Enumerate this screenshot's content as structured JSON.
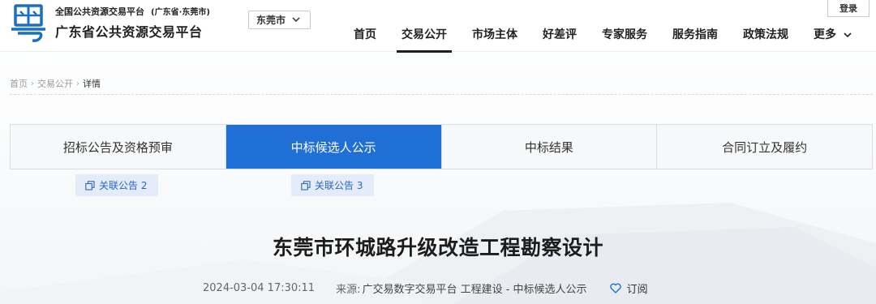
{
  "header": {
    "platform_top": "全国公共资源交易平台",
    "platform_region": "(广东省·东莞市)",
    "platform_name": "广东省公共资源交易平台",
    "city_selected": "东莞市",
    "login_label": "登录",
    "nav": [
      {
        "label": "首页",
        "active": false
      },
      {
        "label": "交易公开",
        "active": true
      },
      {
        "label": "市场主体",
        "active": false
      },
      {
        "label": "好差评",
        "active": false
      },
      {
        "label": "专家服务",
        "active": false
      },
      {
        "label": "服务指南",
        "active": false
      },
      {
        "label": "政策法规",
        "active": false
      },
      {
        "label": "更多",
        "active": false
      }
    ]
  },
  "breadcrumb": {
    "items": [
      "首页",
      "交易公开",
      "详情"
    ]
  },
  "stages": {
    "tabs": [
      {
        "label": "招标公告及资格预审",
        "active": false
      },
      {
        "label": "中标候选人公示",
        "active": true
      },
      {
        "label": "中标结果",
        "active": false
      },
      {
        "label": "合同订立及履约",
        "active": false
      }
    ],
    "related": [
      "关联公告 2",
      "关联公告 3"
    ]
  },
  "article": {
    "title": "东莞市环城路升级改造工程勘察设计",
    "datetime": "2024-03-04 17:30:11",
    "source_label": "来源:",
    "source": "广交易数字交易平台 工程建设 - 中标候选人公示",
    "subscribe_label": "订阅"
  },
  "colors": {
    "accent": "#1f6fd6",
    "badge_bg": "#e3ecf8",
    "badge_text": "#2a66c2"
  },
  "icons": {
    "logo": "guangdong-yue-logo-icon",
    "dropdown": "chevron-down-icon",
    "related": "copy-icon",
    "subscribe": "heart-icon"
  }
}
